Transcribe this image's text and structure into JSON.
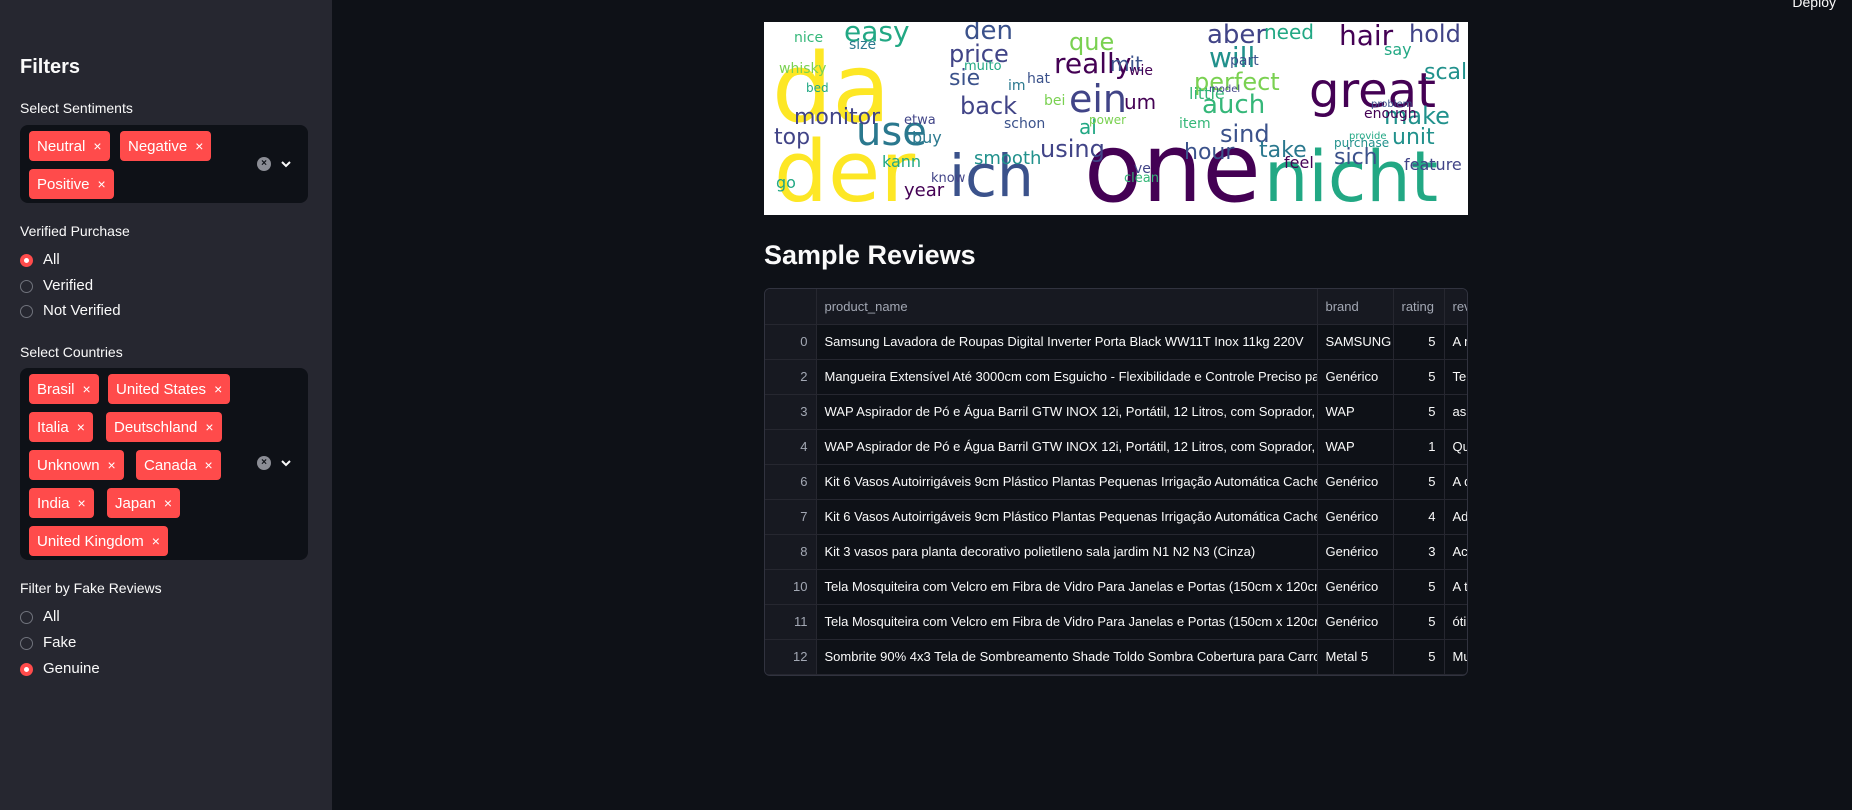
{
  "header": {
    "deploy_label": "Deploy"
  },
  "sidebar": {
    "title": "Filters",
    "sentiments": {
      "label": "Select Sentiments",
      "chips": [
        "Neutral",
        "Negative",
        "Positive"
      ]
    },
    "verified": {
      "label": "Verified Purchase",
      "options": [
        "All",
        "Verified",
        "Not Verified"
      ],
      "selected": "All"
    },
    "countries": {
      "label": "Select Countries",
      "chips": [
        "Brasil",
        "United States",
        "Italia",
        "Deutschland",
        "Unknown",
        "Canada",
        "India",
        "Japan",
        "United Kingdom"
      ]
    },
    "fake": {
      "label": "Filter by Fake Reviews",
      "options": [
        "All",
        "Fake",
        "Genuine"
      ],
      "selected": "Genuine"
    },
    "chip_remove_glyph": "×"
  },
  "wordcloud": {
    "words": [
      "die",
      "da",
      "der",
      "one",
      "nicht",
      "ich",
      "great",
      "easy",
      "den",
      "price",
      "really",
      "will",
      "aber",
      "hold",
      "hair",
      "ein",
      "auch",
      "use",
      "monitor",
      "perfect",
      "sind",
      "make",
      "unit",
      "top",
      "back",
      "sie",
      "mit",
      "que",
      "scale",
      "sich",
      "take",
      "smooth",
      "using",
      "hour",
      "year",
      "kann",
      "go",
      "little",
      "item",
      "feel",
      "feature",
      "um",
      "al",
      "bed",
      "whisky",
      "size",
      "nice",
      "muito",
      "im",
      "schon",
      "buy",
      "know",
      "clean",
      "ve",
      "power",
      "etwa",
      "enough",
      "problem",
      "provide",
      "purchase",
      "say",
      "need",
      "hat",
      "bei",
      "part",
      "wie",
      "model"
    ]
  },
  "main": {
    "section_title": "Sample Reviews",
    "table": {
      "columns": [
        "",
        "product_name",
        "brand",
        "rating",
        "review"
      ],
      "rows": [
        [
          "0",
          "Samsung Lavadora de Roupas Digital Inverter Porta Black WW11T Inox 11kg 220V",
          "SAMSUNG",
          "5",
          "A m"
        ],
        [
          "2",
          "Mangueira Extensível Até 3000cm com Esguicho - Flexibilidade e Controle Preciso para",
          "Genérico",
          "5",
          "Ter"
        ],
        [
          "3",
          "WAP Aspirador de Pó e Água Barril GTW INOX 12i, Portátil, 12 Litros, com Soprador, 17",
          "WAP",
          "5",
          "asp"
        ],
        [
          "4",
          "WAP Aspirador de Pó e Água Barril GTW INOX 12i, Portátil, 12 Litros, com Soprador, 17",
          "WAP",
          "1",
          "Qu"
        ],
        [
          "6",
          "Kit 6 Vasos Autoirrigáveis 9cm Plástico Plantas Pequenas Irrigação Automática Cache",
          "Genérico",
          "5",
          "A q"
        ],
        [
          "7",
          "Kit 6 Vasos Autoirrigáveis 9cm Plástico Plantas Pequenas Irrigação Automática Cache",
          "Genérico",
          "4",
          "Ade"
        ],
        [
          "8",
          "Kit 3 vasos para planta decorativo polietileno sala jardim N1 N2 N3 (Cinza)",
          "Genérico",
          "3",
          "Ach"
        ],
        [
          "10",
          "Tela Mosquiteira com Velcro em Fibra de Vidro Para Janelas e Portas (150cm x 120cm",
          "Genérico",
          "5",
          "A te"
        ],
        [
          "11",
          "Tela Mosquiteira com Velcro em Fibra de Vidro Para Janelas e Portas (150cm x 120cm",
          "Genérico",
          "5",
          "óti"
        ],
        [
          "12",
          "Sombrite 90% 4x3 Tela de Sombreamento Shade Toldo Sombra Cobertura para Carro",
          "Metal 5",
          "5",
          "Mu"
        ]
      ]
    }
  },
  "colors": {
    "accent": "#ff4b4b",
    "sidebar_bg": "#262730",
    "main_bg": "#0e1117"
  }
}
